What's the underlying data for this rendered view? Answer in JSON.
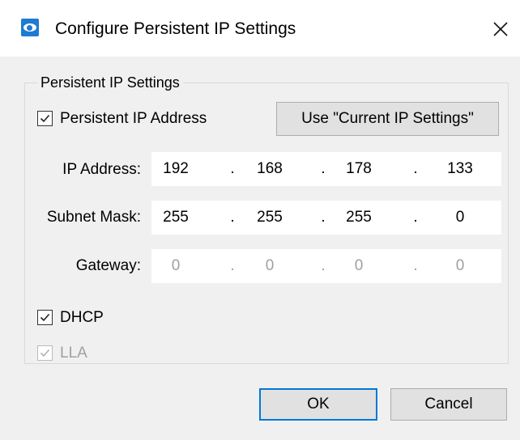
{
  "window": {
    "title": "Configure Persistent IP Settings",
    "app_icon": "eye-logo-icon",
    "close_glyph": "✕"
  },
  "group": {
    "label": "Persistent IP Settings"
  },
  "persistent_ip": {
    "label": "Persistent IP Address",
    "checked": true
  },
  "use_current_button": {
    "label": "Use \"Current IP Settings\""
  },
  "fields": [
    {
      "label": "IP Address:",
      "octets": [
        "192",
        "168",
        "178",
        "133"
      ],
      "enabled": true
    },
    {
      "label": "Subnet Mask:",
      "octets": [
        "255",
        "255",
        "255",
        "0"
      ],
      "enabled": true
    },
    {
      "label": "Gateway:",
      "octets": [
        "0",
        "0",
        "0",
        "0"
      ],
      "enabled": false
    }
  ],
  "separator": ".",
  "dhcp": {
    "label": "DHCP",
    "checked": true,
    "enabled": true
  },
  "lla": {
    "label": "LLA",
    "checked": true,
    "enabled": false
  },
  "buttons": {
    "ok": "OK",
    "cancel": "Cancel"
  },
  "colors": {
    "accent": "#0078d7",
    "dialog_bg": "#f0f0f0",
    "disabled_text": "#a0a0a0"
  }
}
